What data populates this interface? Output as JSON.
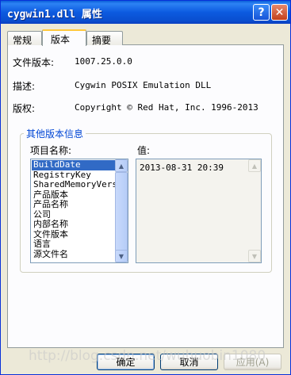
{
  "window": {
    "title": "cygwin1.dll 属性",
    "help_glyph": "?",
    "close_glyph": "✕"
  },
  "tabs": [
    {
      "label": "常规"
    },
    {
      "label": "版本"
    },
    {
      "label": "摘要"
    }
  ],
  "version_info": {
    "file_version_label": "文件版本:",
    "file_version_value": "1007.25.0.0",
    "description_label": "描述:",
    "description_value": "Cygwin POSIX Emulation DLL",
    "copyright_label": "版权:",
    "copyright_value": "Copyright © Red Hat, Inc. 1996-2013"
  },
  "other_info": {
    "group_title": "其他版本信息",
    "item_name_label": "项目名称:",
    "value_label": "值:",
    "items": [
      "BuildDate",
      "RegistryKey",
      "SharedMemoryVersi",
      "产品版本",
      "产品名称",
      "公司",
      "内部名称",
      "文件版本",
      "语言",
      "源文件名"
    ],
    "selected_index": 0,
    "selected_value": "2013-08-31 20:39"
  },
  "buttons": {
    "ok": "确定",
    "cancel": "取消",
    "apply": "应用(A)"
  },
  "watermark": "http://blog.csdn.net/wuhuobin1080"
}
